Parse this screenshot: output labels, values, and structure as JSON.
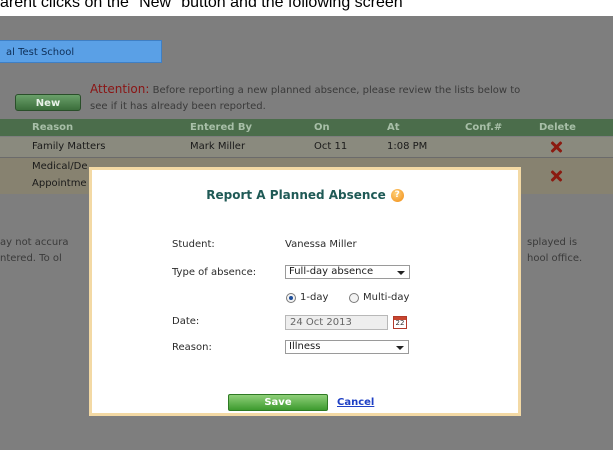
{
  "caption": "arent clicks on the \"New\" button and the following screen",
  "school_bar": "al Test School",
  "new_button": "New",
  "attention": {
    "label": "Attention:",
    "line1": "Before reporting a new planned absence, please review the lists below to",
    "line2": "see if it has already been reported."
  },
  "table": {
    "columns": [
      "Reason",
      "Entered By",
      "On",
      "At",
      "Conf.#",
      "Delete"
    ],
    "rows": [
      {
        "reason": "Family Matters",
        "entered_by": "Mark Miller",
        "on": "Oct 11",
        "at": "1:08 PM"
      },
      {
        "reason_line1": "Medical/De",
        "reason_line2": "Appointme"
      }
    ]
  },
  "background_text": {
    "left1": "ay not accura",
    "left2": "ntered. To ol",
    "right1": "splayed is",
    "right2": "hool office."
  },
  "modal": {
    "title": "Report A Planned Absence",
    "student_label": "Student:",
    "student_value": "Vanessa Miller",
    "type_label": "Type of absence:",
    "type_value": "Full-day absence",
    "radio_one_day": "1-day",
    "radio_multi_day": "Multi-day",
    "date_label": "Date:",
    "date_value": "24 Oct 2013",
    "calendar_day": "22",
    "reason_label": "Reason:",
    "reason_value": "Illness",
    "save_label": "Save",
    "cancel_label": "Cancel"
  },
  "colors": {
    "header_green": "#4b6d4b",
    "new_button": "#3b6e3b",
    "modal_border": "#f3d9a4",
    "title_teal": "#1f5a56",
    "save_green": "#3d9a2f",
    "link_blue": "#1e3fc4"
  }
}
